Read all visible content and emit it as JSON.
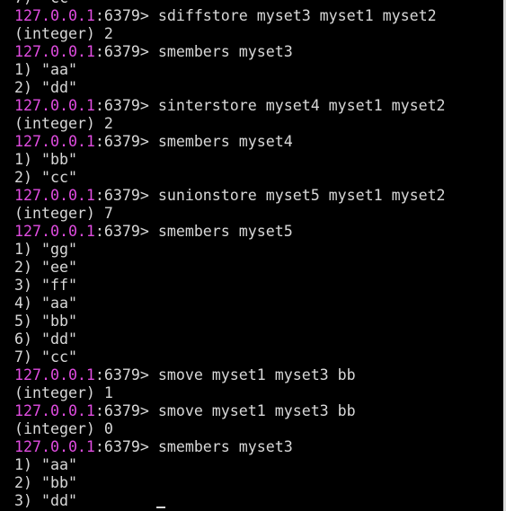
{
  "terminal": {
    "prompt_host": "127.0.0.1",
    "prompt_rest": ":6379> ",
    "lines": [
      {
        "type": "output",
        "text": "7) \"cc\""
      },
      {
        "type": "prompt",
        "text": "sdiffstore myset3 myset1 myset2"
      },
      {
        "type": "output",
        "text": "(integer) 2"
      },
      {
        "type": "prompt",
        "text": "smembers myset3"
      },
      {
        "type": "output",
        "text": "1) \"aa\""
      },
      {
        "type": "output",
        "text": "2) \"dd\""
      },
      {
        "type": "prompt",
        "text": "sinterstore myset4 myset1 myset2"
      },
      {
        "type": "output",
        "text": "(integer) 2"
      },
      {
        "type": "prompt",
        "text": "smembers myset4"
      },
      {
        "type": "output",
        "text": "1) \"bb\""
      },
      {
        "type": "output",
        "text": "2) \"cc\""
      },
      {
        "type": "prompt",
        "text": "sunionstore myset5 myset1 myset2"
      },
      {
        "type": "output",
        "text": "(integer) 7"
      },
      {
        "type": "prompt",
        "text": "smembers myset5"
      },
      {
        "type": "output",
        "text": "1) \"gg\""
      },
      {
        "type": "output",
        "text": "2) \"ee\""
      },
      {
        "type": "output",
        "text": "3) \"ff\""
      },
      {
        "type": "output",
        "text": "4) \"aa\""
      },
      {
        "type": "output",
        "text": "5) \"bb\""
      },
      {
        "type": "output",
        "text": "6) \"dd\""
      },
      {
        "type": "output",
        "text": "7) \"cc\""
      },
      {
        "type": "prompt",
        "text": "smove myset1 myset3 bb"
      },
      {
        "type": "output",
        "text": "(integer) 1"
      },
      {
        "type": "prompt",
        "text": "smove myset1 myset3 bb"
      },
      {
        "type": "output",
        "text": "(integer) 0"
      },
      {
        "type": "prompt",
        "text": "smembers myset3"
      },
      {
        "type": "output",
        "text": "1) \"aa\""
      },
      {
        "type": "output",
        "text": "2) \"bb\""
      },
      {
        "type": "output",
        "text": "3) \"dd\""
      }
    ]
  },
  "colors": {
    "background": "#000000",
    "text": "#d8d8d8",
    "host": "#e04ce0"
  }
}
